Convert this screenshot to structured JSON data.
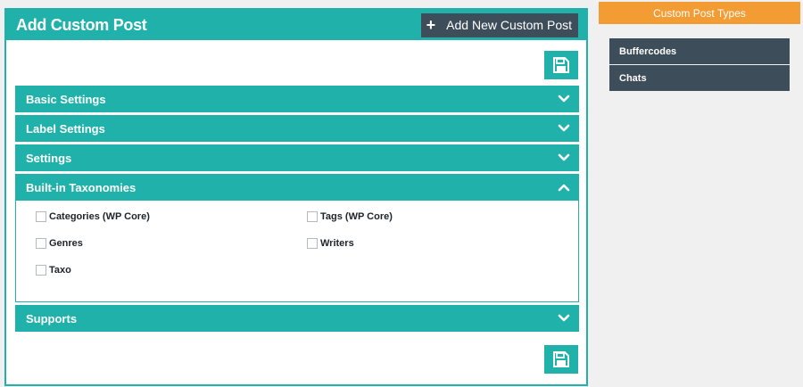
{
  "panel": {
    "title": "Add Custom Post",
    "add_button_label": "Add New Custom Post"
  },
  "accordions": [
    {
      "label": "Basic Settings",
      "expanded": false
    },
    {
      "label": "Label Settings",
      "expanded": false
    },
    {
      "label": "Settings",
      "expanded": false
    },
    {
      "label": "Built-in Taxonomies",
      "expanded": true
    },
    {
      "label": "Supports",
      "expanded": false
    }
  ],
  "taxonomies": [
    {
      "label": "Categories (WP Core)",
      "checked": false
    },
    {
      "label": "Tags (WP Core)",
      "checked": false
    },
    {
      "label": "Genres",
      "checked": false
    },
    {
      "label": "Writers",
      "checked": false
    },
    {
      "label": "Taxo",
      "checked": false
    }
  ],
  "sidebar": {
    "title": "Custom Post Types",
    "items": [
      {
        "label": "Buffercodes"
      },
      {
        "label": "Chats"
      }
    ]
  },
  "colors": {
    "accent": "#20b2aa",
    "dark": "#3e4d5a",
    "orange": "#f39c34"
  },
  "icons": {
    "save": "floppy-disk-icon",
    "expand": "chevron-down-icon",
    "collapse": "chevron-up-icon",
    "add": "plus-icon"
  }
}
